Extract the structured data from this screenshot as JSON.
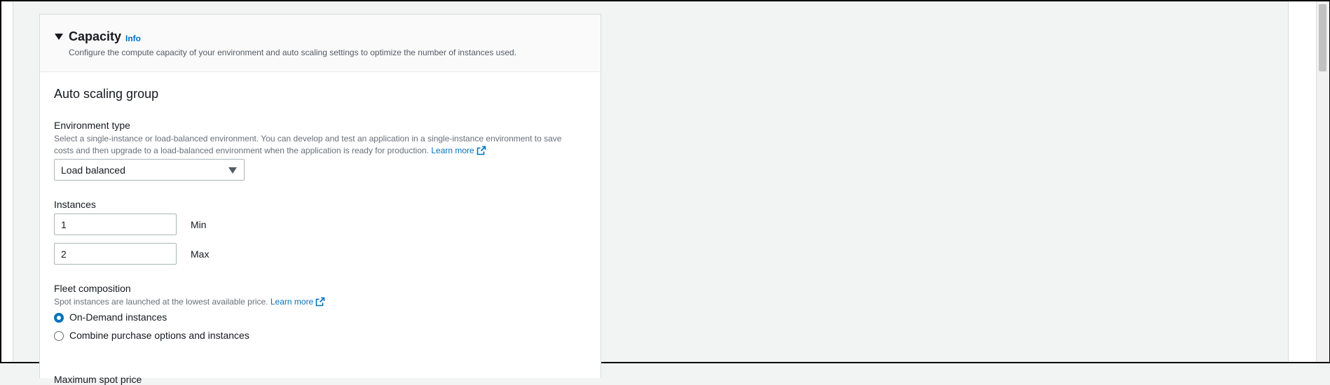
{
  "capacity": {
    "title": "Capacity",
    "info_label": "Info",
    "description": "Configure the compute capacity of your environment and auto scaling settings to optimize the number of instances used."
  },
  "auto_scaling": {
    "title": "Auto scaling group",
    "environment_type": {
      "label": "Environment type",
      "description_line1": "Select a single-instance or load-balanced environment. You can develop and test an application in a single-instance environment to save",
      "description_line2": "costs and then upgrade to a load-balanced environment when the application is ready for production.",
      "learn_more": "Learn more",
      "selected_value": "Load balanced"
    },
    "instances": {
      "label": "Instances",
      "min_value": "1",
      "min_label": "Min",
      "max_value": "2",
      "max_label": "Max"
    },
    "fleet_composition": {
      "label": "Fleet composition",
      "description": "Spot instances are launched at the lowest available price.",
      "learn_more": "Learn more",
      "options": [
        {
          "label": "On-Demand instances",
          "selected": true
        },
        {
          "label": "Combine purchase options and instances",
          "selected": false
        }
      ]
    },
    "next_label_clipped": "Maximum spot price"
  },
  "colors": {
    "link": "#0073bb",
    "page_bg": "#f2f3f3",
    "radio_selected": "#0073bb"
  },
  "icons": {
    "section_toggle": "caret-down-icon",
    "external_link": "external-link-icon",
    "select_toggle": "triangle-down-icon"
  }
}
